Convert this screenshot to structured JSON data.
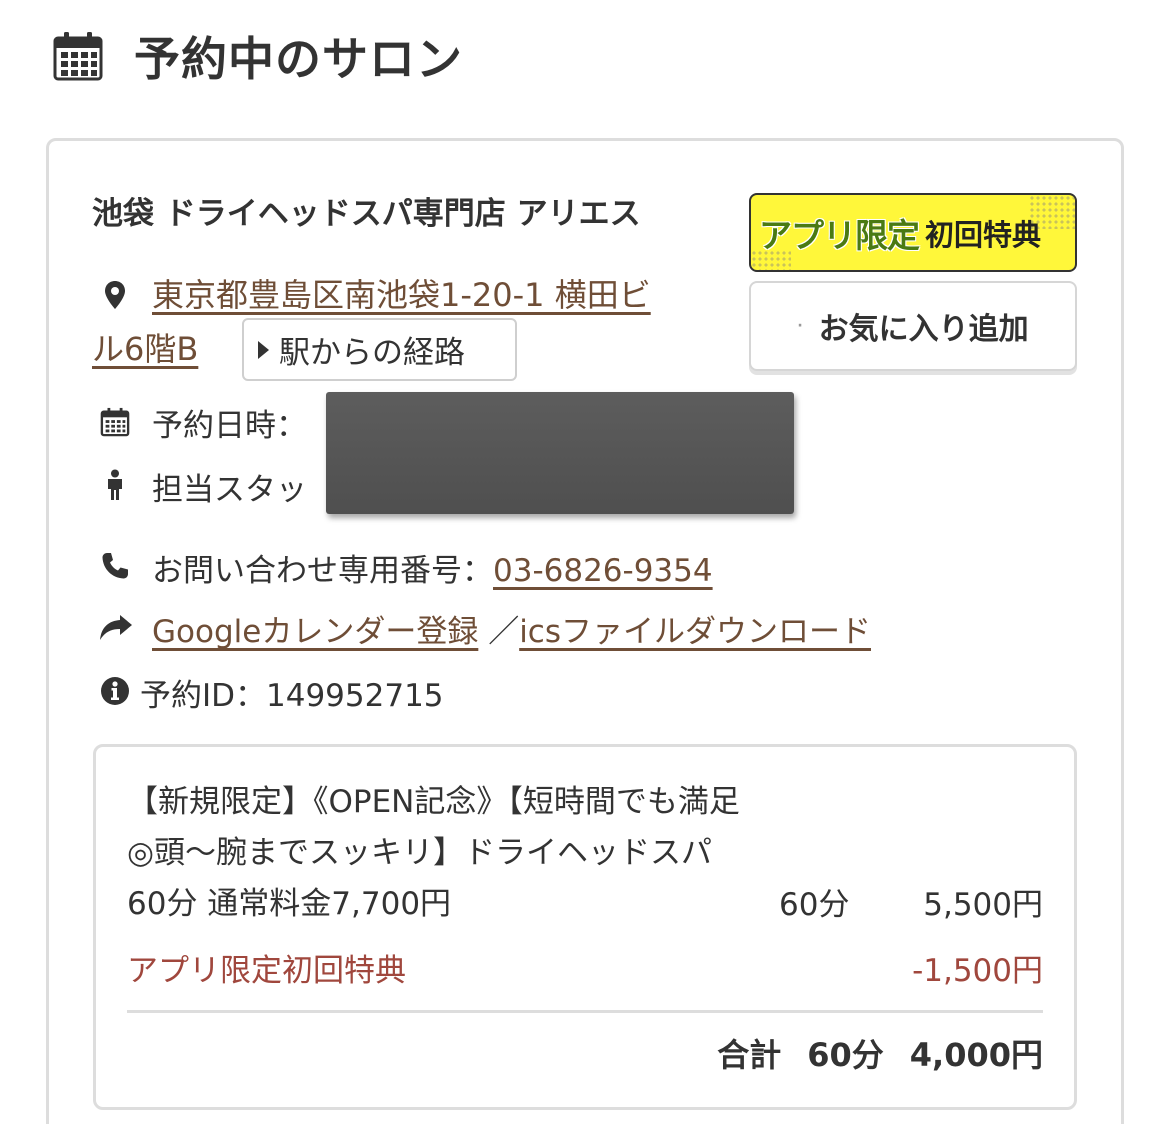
{
  "page": {
    "title": "予約中のサロン"
  },
  "salon": {
    "name": "池袋 ドライヘッドスパ専門店 アリエス",
    "address_line1": "東京都豊島区南池袋1-20-1 横田ビ",
    "address_line2": "ル6階B",
    "route_label": "駅からの経路"
  },
  "badge": {
    "main": "アプリ限定",
    "sub": "初回特典"
  },
  "favorite": {
    "label": "お気に入り追加"
  },
  "reservation": {
    "date_label": "予約日時：",
    "staff_label": "担当スタッ",
    "phone_label": "お問い合わせ専用番号：",
    "phone_number": "03-6826-9354",
    "google_calendar": "Googleカレンダー登録",
    "separator": "／",
    "ics_download": "icsファイルダウンロード",
    "id_label": "予約ID：",
    "id_value": "149952715"
  },
  "menu": {
    "name": "【新規限定】《OPEN記念》【短時間でも満足◎頭～腕までスッキリ】ドライヘッドスパ 60分 通常料金7,700円",
    "duration": "60分",
    "price": "5,500円",
    "discount_label": "アプリ限定初回特典",
    "discount_value": "-1,500円",
    "total_label": "合計",
    "total_duration": "60分",
    "total_price": "4,000円"
  },
  "icons": [
    "calendar-icon",
    "location-pin-icon",
    "person-icon",
    "phone-icon",
    "share-arrow-icon",
    "info-icon"
  ],
  "colors": {
    "link": "#6f4e37",
    "discount": "#a0473d",
    "badge_bg": "#fff73a",
    "badge_text": "#4a7a12"
  }
}
